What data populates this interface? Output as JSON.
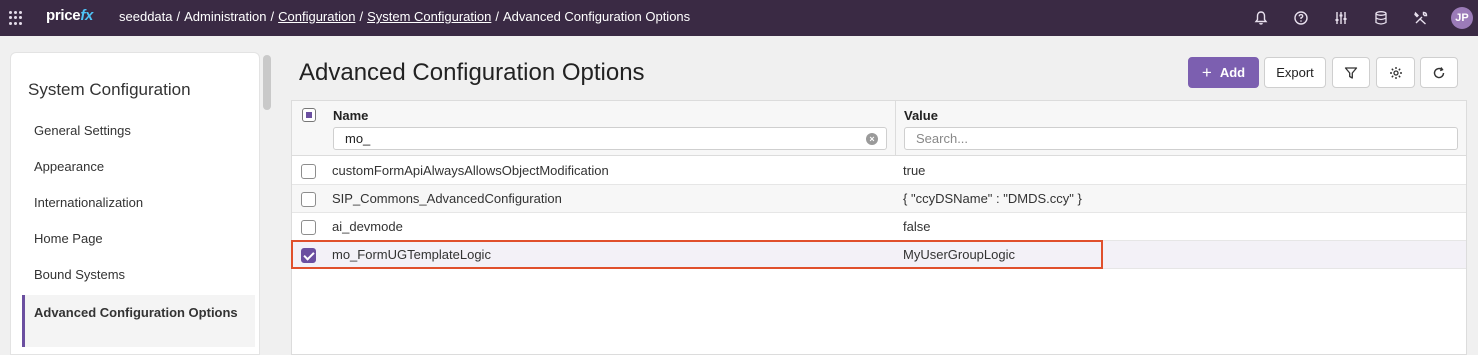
{
  "app": {
    "logo_main": "price",
    "logo_accent": "fx"
  },
  "breadcrumb": {
    "items": [
      {
        "label": "seeddata",
        "link": false
      },
      {
        "label": "Administration",
        "link": false
      },
      {
        "label": "Configuration",
        "link": true
      },
      {
        "label": "System Configuration",
        "link": true
      },
      {
        "label": "Advanced Configuration Options",
        "link": false
      }
    ],
    "separator": "/"
  },
  "topbar": {
    "icons": [
      "bell-icon",
      "help-icon",
      "sliders-icon",
      "database-icon",
      "tools-icon"
    ],
    "avatar_initials": "JP"
  },
  "sidebar": {
    "title": "System Configuration",
    "items": [
      {
        "label": "General Settings"
      },
      {
        "label": "Appearance"
      },
      {
        "label": "Internationalization"
      },
      {
        "label": "Home Page"
      },
      {
        "label": "Bound Systems"
      },
      {
        "label": "Advanced Configuration Options",
        "active": true
      }
    ]
  },
  "main": {
    "title": "Advanced Configuration Options",
    "buttons": {
      "add": "Add",
      "export": "Export"
    }
  },
  "table": {
    "columns": [
      "Name",
      "Value"
    ],
    "filters": {
      "name_value": "mo_",
      "value_placeholder": "Search..."
    },
    "rows": [
      {
        "name": "customFormApiAlwaysAllowsObjectModification",
        "value": "true",
        "checked": false
      },
      {
        "name": "SIP_Commons_AdvancedConfiguration",
        "value": "{ \"ccyDSName\" : \"DMDS.ccy\" }",
        "checked": false
      },
      {
        "name": "ai_devmode",
        "value": "false",
        "checked": false
      },
      {
        "name": "mo_FormUGTemplateLogic",
        "value": "MyUserGroupLogic",
        "checked": true
      }
    ]
  },
  "colors": {
    "topbar": "#3a2a44",
    "accent": "#7c5fb0",
    "highlight": "#e0502c"
  }
}
